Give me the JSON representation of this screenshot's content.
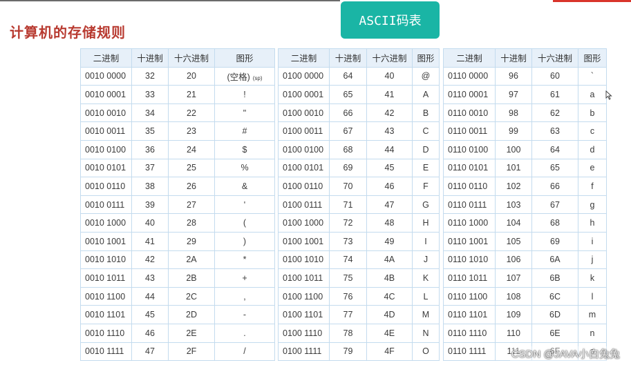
{
  "title": "计算机的存储规则",
  "badge": "ASCII码表",
  "columns": [
    "二进制",
    "十进制",
    "十六进制",
    "图形"
  ],
  "tables": [
    {
      "rows": [
        [
          "0010 0000",
          "32",
          "20",
          [
            "(空格)",
            "(sp)"
          ]
        ],
        [
          "0010 0001",
          "33",
          "21",
          "!"
        ],
        [
          "0010 0010",
          "34",
          "22",
          "\""
        ],
        [
          "0010 0011",
          "35",
          "23",
          "#"
        ],
        [
          "0010 0100",
          "36",
          "24",
          "$"
        ],
        [
          "0010 0101",
          "37",
          "25",
          "%"
        ],
        [
          "0010 0110",
          "38",
          "26",
          "&"
        ],
        [
          "0010 0111",
          "39",
          "27",
          "'"
        ],
        [
          "0010 1000",
          "40",
          "28",
          "("
        ],
        [
          "0010 1001",
          "41",
          "29",
          ")"
        ],
        [
          "0010 1010",
          "42",
          "2A",
          "*"
        ],
        [
          "0010 1011",
          "43",
          "2B",
          "+"
        ],
        [
          "0010 1100",
          "44",
          "2C",
          ","
        ],
        [
          "0010 1101",
          "45",
          "2D",
          "-"
        ],
        [
          "0010 1110",
          "46",
          "2E",
          "."
        ],
        [
          "0010 1111",
          "47",
          "2F",
          "/"
        ]
      ]
    },
    {
      "rows": [
        [
          "0100 0000",
          "64",
          "40",
          "@"
        ],
        [
          "0100 0001",
          "65",
          "41",
          "A"
        ],
        [
          "0100 0010",
          "66",
          "42",
          "B"
        ],
        [
          "0100 0011",
          "67",
          "43",
          "C"
        ],
        [
          "0100 0100",
          "68",
          "44",
          "D"
        ],
        [
          "0100 0101",
          "69",
          "45",
          "E"
        ],
        [
          "0100 0110",
          "70",
          "46",
          "F"
        ],
        [
          "0100 0111",
          "71",
          "47",
          "G"
        ],
        [
          "0100 1000",
          "72",
          "48",
          "H"
        ],
        [
          "0100 1001",
          "73",
          "49",
          "I"
        ],
        [
          "0100 1010",
          "74",
          "4A",
          "J"
        ],
        [
          "0100 1011",
          "75",
          "4B",
          "K"
        ],
        [
          "0100 1100",
          "76",
          "4C",
          "L"
        ],
        [
          "0100 1101",
          "77",
          "4D",
          "M"
        ],
        [
          "0100 1110",
          "78",
          "4E",
          "N"
        ],
        [
          "0100 1111",
          "79",
          "4F",
          "O"
        ]
      ]
    },
    {
      "rows": [
        [
          "0110 0000",
          "96",
          "60",
          "`"
        ],
        [
          "0110 0001",
          "97",
          "61",
          "a"
        ],
        [
          "0110 0010",
          "98",
          "62",
          "b"
        ],
        [
          "0110 0011",
          "99",
          "63",
          "c"
        ],
        [
          "0110 0100",
          "100",
          "64",
          "d"
        ],
        [
          "0110 0101",
          "101",
          "65",
          "e"
        ],
        [
          "0110 0110",
          "102",
          "66",
          "f"
        ],
        [
          "0110 0111",
          "103",
          "67",
          "g"
        ],
        [
          "0110 1000",
          "104",
          "68",
          "h"
        ],
        [
          "0110 1001",
          "105",
          "69",
          "i"
        ],
        [
          "0110 1010",
          "106",
          "6A",
          "j"
        ],
        [
          "0110 1011",
          "107",
          "6B",
          "k"
        ],
        [
          "0110 1100",
          "108",
          "6C",
          "l"
        ],
        [
          "0110 1101",
          "109",
          "6D",
          "m"
        ],
        [
          "0110 1110",
          "110",
          "6E",
          "n"
        ],
        [
          "0110 1111",
          "111",
          "6F",
          "o"
        ]
      ]
    }
  ],
  "watermark": "CSDN @JAVA小白兔兔",
  "colors": {
    "title": "#b83a30",
    "badge": "#1ab5a5",
    "header_bg": "#e7f0f9",
    "border": "#c3dbee",
    "text": "#333333",
    "top_accent": "#d9342b"
  },
  "icons": {
    "cursor": "mouse-cursor-icon"
  }
}
